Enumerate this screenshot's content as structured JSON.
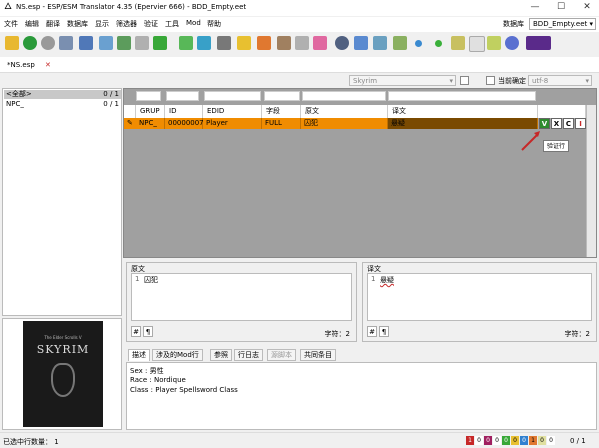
{
  "title": "NS.esp - ESP/ESM Translator 4.35 (Epervier 666) - BDD_Empty.eet",
  "menu": [
    "文件",
    "编辑",
    "翻译",
    "数据库",
    "显示",
    "筛选器",
    "验证",
    "工具",
    "Mod",
    "帮助"
  ],
  "db_label": "数据库",
  "db_value": "BDD_Empty.eet",
  "doc_tab": "*NS.esp",
  "filters": {
    "game": "Skyrim",
    "current_only": "当前确定",
    "encoding": "utf-8"
  },
  "left_list": [
    {
      "label": "<全部>",
      "count": "0 / 1"
    },
    {
      "label": "NPC_",
      "count": "0 / 1"
    }
  ],
  "grid": {
    "headers": [
      "GRUP",
      "ID",
      "EDID",
      "字段",
      "原文",
      "译文"
    ],
    "row": {
      "grup": "NPC_",
      "id": "00000007",
      "edid": "Player",
      "field": "FULL",
      "source": "囚犯",
      "target": "悬疑"
    },
    "btn_v": "V",
    "btn_x": "X",
    "btn_c": "C",
    "btn_i": "I",
    "tooltip": "验证行"
  },
  "source_panel": {
    "label": "原文",
    "line": "1",
    "text": "囚犯",
    "hash": "#",
    "pilcrow": "¶",
    "chars": "字符：2"
  },
  "target_panel": {
    "label": "译文",
    "line": "1",
    "text": "悬疑",
    "hash": "#",
    "pilcrow": "¶",
    "chars": "字符：2"
  },
  "info_tabs": [
    "描述",
    "涉及的Mod行",
    "参照",
    "行日志",
    "源脚本",
    "共同条目"
  ],
  "info_lines": [
    "Sex : 男性",
    "Race : Nordique",
    "Class : Player Spellsword Class"
  ],
  "splash": {
    "small": "The Elder Scrolls V",
    "big": "SKYRIM"
  },
  "status": {
    "left": "已选中行数量： 1",
    "counts": [
      "1",
      "0",
      "0",
      "0",
      "0",
      "0",
      "0",
      "1",
      "0",
      "0"
    ],
    "tail": "0 / 1"
  },
  "colors": {
    "row_bg": "#f08c00",
    "row_dark": "#7a4a00",
    "accent_green": "#2e8b2e",
    "red": "#c62828"
  }
}
